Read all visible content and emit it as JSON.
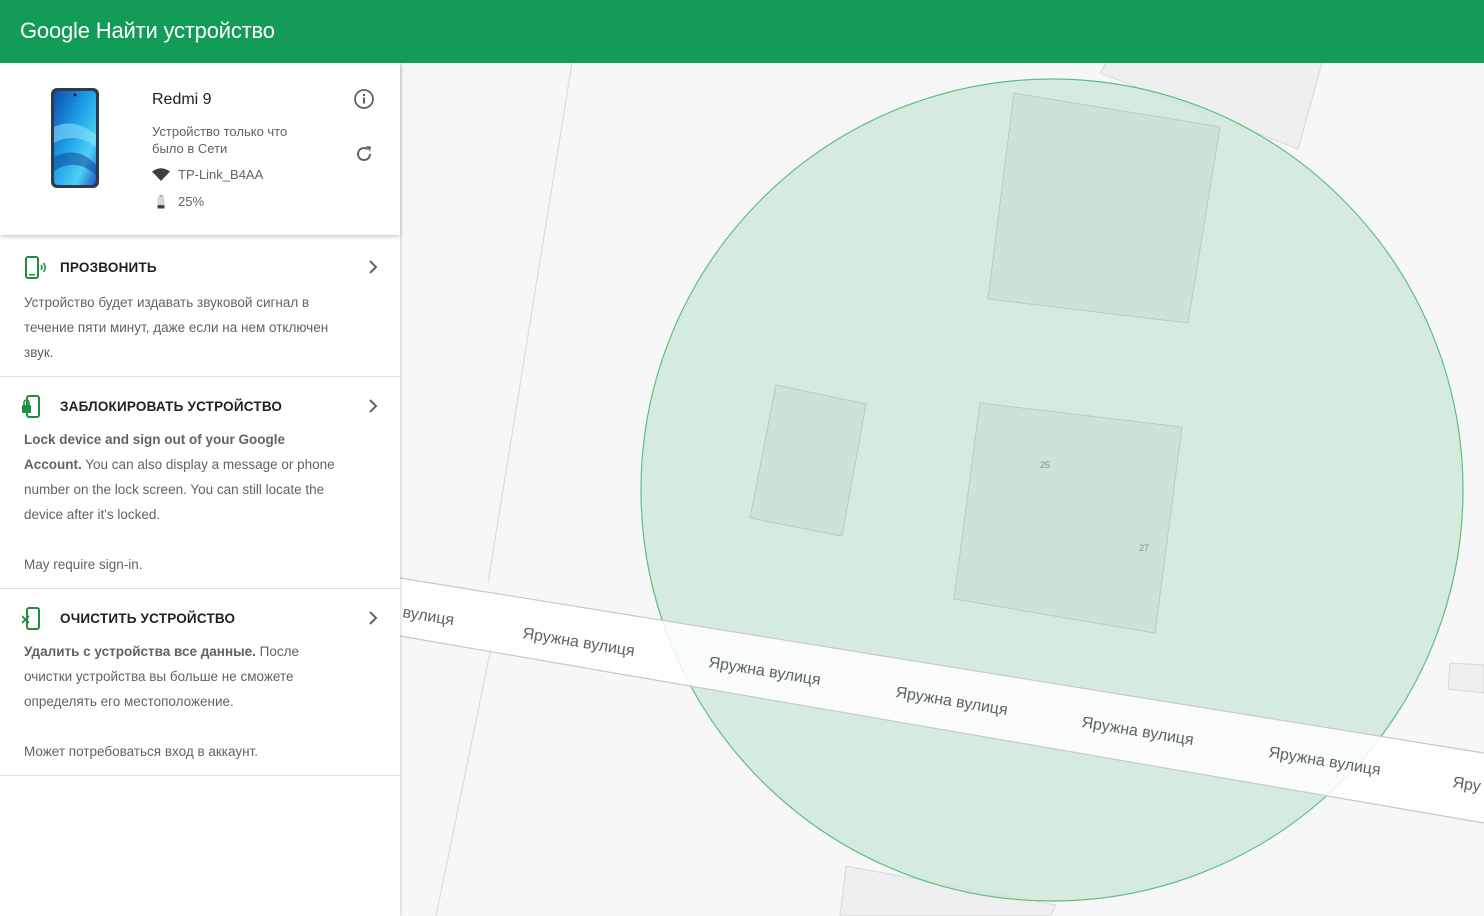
{
  "header": {
    "brand": "Google",
    "title": "Найти устройство"
  },
  "device": {
    "name": "Redmi 9",
    "status": "Устройство только что было в Сети",
    "wifi": "TP-Link_B4AA",
    "battery": "25%"
  },
  "actions": [
    {
      "title": "ПРОЗВОНИТЬ",
      "desc": "Устройство будет издавать звуковой сигнал в течение пяти минут, даже если на нем отключен звук."
    },
    {
      "title": "ЗАБЛОКИРОВАТЬ УСТРОЙСТВО",
      "desc_bold": "Lock device and sign out of your Google Account.",
      "desc_rest": " You can also display a message or phone number on the lock screen. You can still locate the device after it's locked.",
      "note": "May require sign-in."
    },
    {
      "title": "ОЧИСТИТЬ УСТРОЙСТВО",
      "desc_bold": "Удалить с устройства все данные.",
      "desc_rest": " После очистки устройства вы больше не сможете определять его местоположение.",
      "note": "Может потребоваться вход в аккаунт."
    }
  ],
  "map": {
    "street_label": "Яружна вулиця",
    "street_label_cut_left": "вулиця",
    "street_label_cut_right": "Яру",
    "house_numbers": [
      "25",
      "27"
    ]
  },
  "colors": {
    "header": "#129c57",
    "accent": "#1e8e3e",
    "accuracy_fill": "#cde8d8",
    "accuracy_stroke": "#5bbf85"
  }
}
